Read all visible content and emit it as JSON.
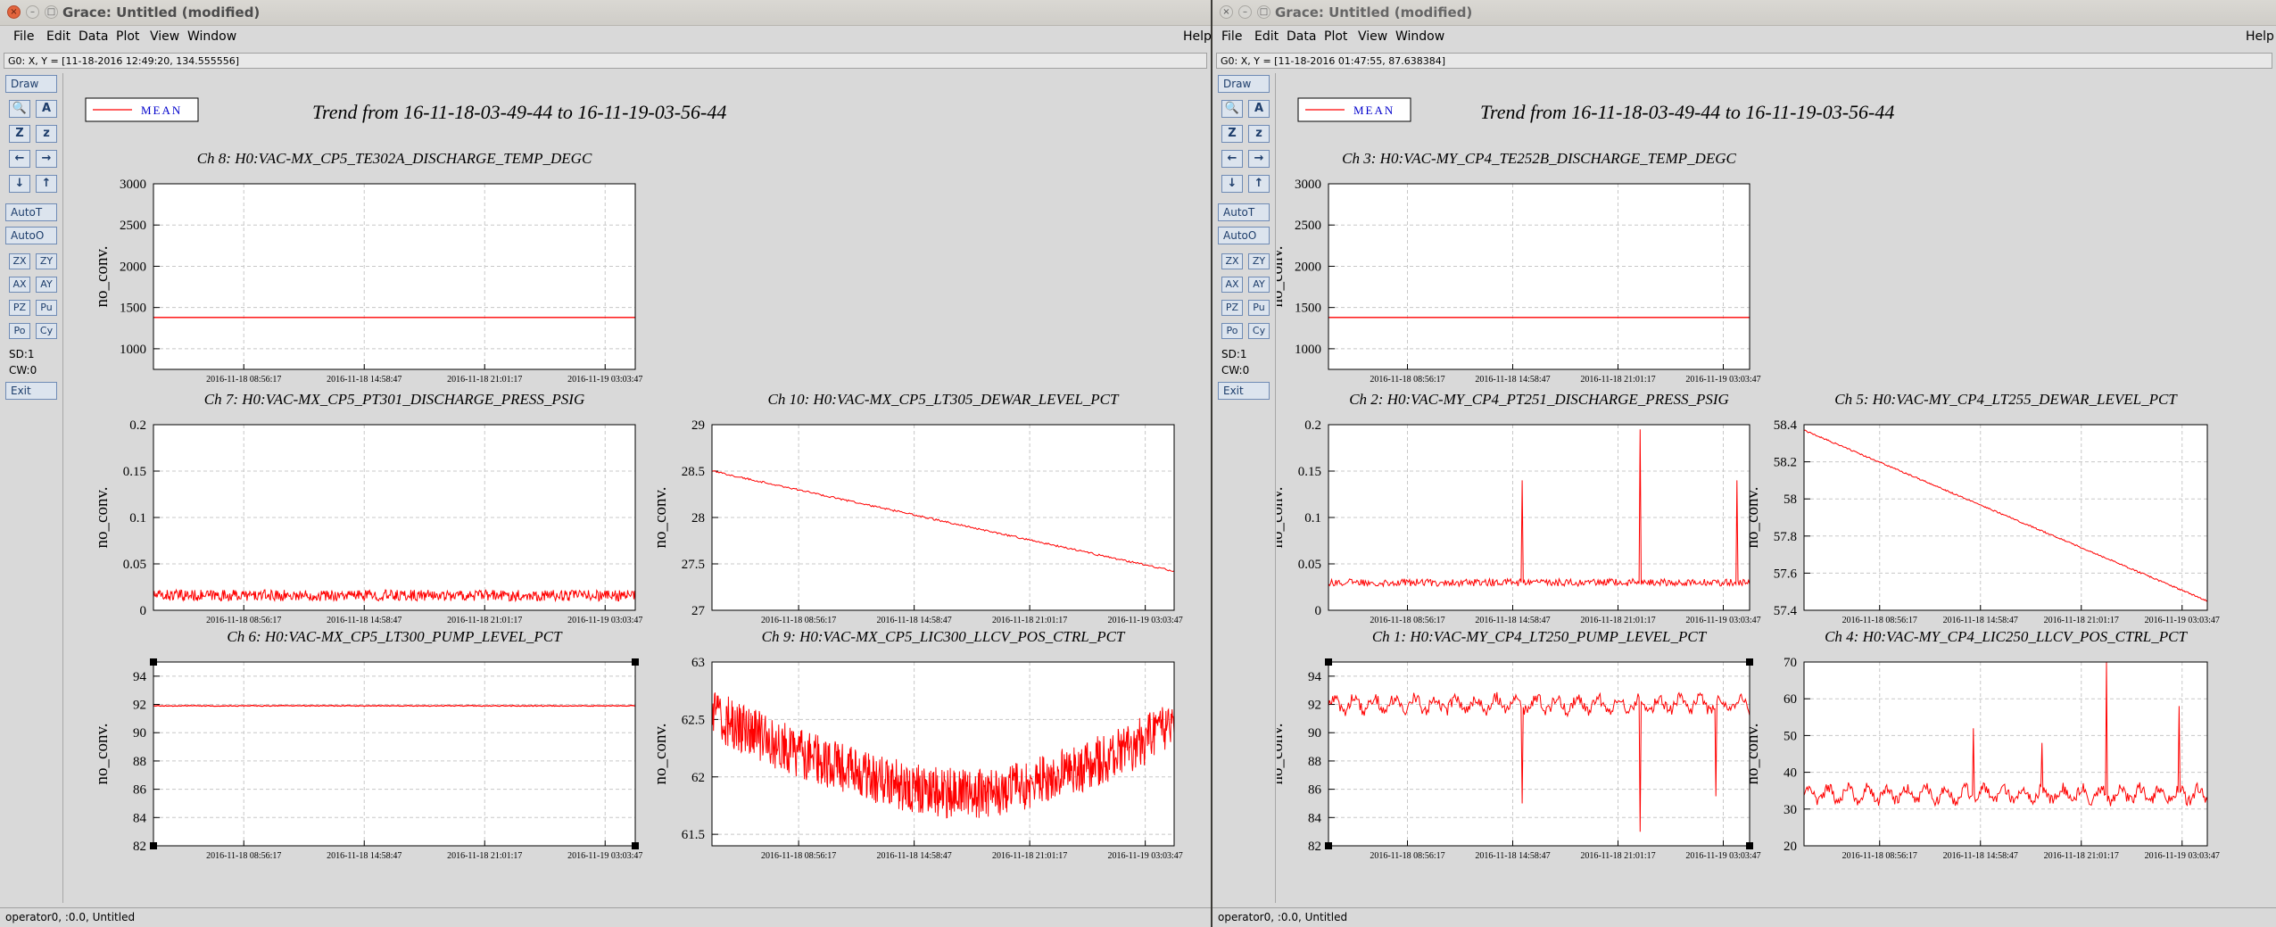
{
  "windows": [
    {
      "id": "L",
      "title": "Grace: Untitled (modified)",
      "status": "G0: X, Y = [11-18-2016 12:49:20, 134.555556]",
      "bottom": "operator0, :0.0, Untitled",
      "legend": "MEAN",
      "heading": "Trend from 16-11-18-03-49-44 to 16-11-19-03-56-44"
    },
    {
      "id": "R",
      "title": "Grace: Untitled (modified)",
      "status": "G0: X, Y = [11-18-2016 01:47:55, 87.638384]",
      "bottom": "operator0, :0.0, Untitled",
      "legend": "MEAN",
      "heading": "Trend from 16-11-18-03-49-44 to 16-11-19-03-56-44"
    }
  ],
  "menu": {
    "file": "File",
    "edit": "Edit",
    "data": "Data",
    "plot": "Plot",
    "view": "View",
    "window": "Window",
    "help": "Help"
  },
  "toolbar": {
    "draw": "Draw",
    "autot": "AutoT",
    "autoo": "AutoO",
    "zx": "ZX",
    "zy": "ZY",
    "ax": "AX",
    "ay": "AY",
    "pz": "PZ",
    "pu": "Pu",
    "po": "Po",
    "cy": "Cy",
    "sd": "SD:1",
    "cw": "CW:0",
    "exit": "Exit",
    "zoom": "Z",
    "zoom2": "z"
  },
  "xticks": [
    "2016-11-18 08:56:17",
    "2016-11-18 14:58:47",
    "2016-11-18 21:01:17",
    "2016-11-19 03:03:47"
  ],
  "ylabel": "no_conv.",
  "chart_data": [
    {
      "window": "L",
      "slot": 0,
      "type": "line",
      "title": "Ch 8: H0:VAC-MX_CP5_TE302A_DISCHARGE_TEMP_DEGC",
      "ylim": [
        750,
        3000
      ],
      "yticks": [
        "1000",
        "1500",
        "2000",
        "2500",
        "3000"
      ],
      "ytickvals": [
        1000,
        1500,
        2000,
        2500,
        3000
      ],
      "pattern": "flat",
      "base": 1380,
      "noise": 0,
      "series": [
        {
          "name": "MEAN"
        }
      ]
    },
    {
      "window": "L",
      "slot": 1,
      "type": "line",
      "title": "Ch 7: H0:VAC-MX_CP5_PT301_DISCHARGE_PRESS_PSIG",
      "ylim": [
        0,
        0.2
      ],
      "yticks": [
        "0",
        "0.05",
        "0.1",
        "0.15",
        "0.2"
      ],
      "ytickvals": [
        0,
        0.05,
        0.1,
        0.15,
        0.2
      ],
      "pattern": "noisy-flat",
      "base": 0.016,
      "noise": 0.006,
      "series": [
        {
          "name": "MEAN"
        }
      ]
    },
    {
      "window": "L",
      "slot": 2,
      "type": "line",
      "title": "Ch 10: H0:VAC-MX_CP5_LT305_DEWAR_LEVEL_PCT",
      "ylim": [
        27,
        29
      ],
      "yticks": [
        "27",
        "27.5",
        "28",
        "28.5",
        "29"
      ],
      "ytickvals": [
        27,
        27.5,
        28,
        28.5,
        29
      ],
      "pattern": "linear",
      "start": 28.5,
      "end": 27.42,
      "noise": 0.01,
      "series": [
        {
          "name": "MEAN"
        }
      ]
    },
    {
      "window": "L",
      "slot": 3,
      "type": "line",
      "title": "Ch 6: H0:VAC-MX_CP5_LT300_PUMP_LEVEL_PCT",
      "ylim": [
        82,
        95
      ],
      "yticks": [
        "82",
        "84",
        "86",
        "88",
        "90",
        "92",
        "94"
      ],
      "ytickvals": [
        82,
        84,
        86,
        88,
        90,
        92,
        94
      ],
      "pattern": "flat",
      "base": 91.9,
      "noise": 0.03,
      "series": [
        {
          "name": "MEAN"
        }
      ]
    },
    {
      "window": "L",
      "slot": 4,
      "type": "line",
      "title": "Ch 9: H0:VAC-MX_CP5_LIC300_LLCV_POS_CTRL_PCT",
      "ylim": [
        61.4,
        63
      ],
      "yticks": [
        "61.5",
        "62",
        "62.5",
        "63"
      ],
      "ytickvals": [
        61.5,
        62,
        62.5,
        63
      ],
      "pattern": "dip",
      "start": 62.55,
      "mid": 61.85,
      "end": 62.45,
      "noise": 0.22,
      "series": [
        {
          "name": "MEAN"
        }
      ]
    },
    {
      "window": "R",
      "slot": 0,
      "type": "line",
      "title": "Ch 3: H0:VAC-MY_CP4_TE252B_DISCHARGE_TEMP_DEGC",
      "ylim": [
        750,
        3000
      ],
      "yticks": [
        "1000",
        "1500",
        "2000",
        "2500",
        "3000"
      ],
      "ytickvals": [
        1000,
        1500,
        2000,
        2500,
        3000
      ],
      "pattern": "flat",
      "base": 1380,
      "noise": 0,
      "series": [
        {
          "name": "MEAN"
        }
      ]
    },
    {
      "window": "R",
      "slot": 1,
      "type": "line",
      "title": "Ch 2: H0:VAC-MY_CP4_PT251_DISCHARGE_PRESS_PSIG",
      "ylim": [
        0,
        0.2
      ],
      "yticks": [
        "0",
        "0.05",
        "0.1",
        "0.15",
        "0.2"
      ],
      "ytickvals": [
        0,
        0.05,
        0.1,
        0.15,
        0.2
      ],
      "pattern": "spiky",
      "base": 0.03,
      "noise": 0.004,
      "spikes": [
        [
          0.46,
          0.14
        ],
        [
          0.74,
          0.195
        ],
        [
          0.97,
          0.14
        ]
      ],
      "series": [
        {
          "name": "MEAN"
        }
      ]
    },
    {
      "window": "R",
      "slot": 2,
      "type": "line",
      "title": "Ch 5: H0:VAC-MY_CP4_LT255_DEWAR_LEVEL_PCT",
      "ylim": [
        57.4,
        58.4
      ],
      "yticks": [
        "57.4",
        "57.6",
        "57.8",
        "58",
        "58.2",
        "58.4"
      ],
      "ytickvals": [
        57.4,
        57.6,
        57.8,
        58,
        58.2,
        58.4
      ],
      "pattern": "linear",
      "start": 58.37,
      "end": 57.45,
      "noise": 0.004,
      "series": [
        {
          "name": "MEAN"
        }
      ]
    },
    {
      "window": "R",
      "slot": 3,
      "type": "line",
      "title": "Ch 1: H0:VAC-MY_CP4_LT250_PUMP_LEVEL_PCT",
      "ylim": [
        82,
        95
      ],
      "yticks": [
        "82",
        "84",
        "86",
        "88",
        "90",
        "92",
        "94"
      ],
      "ytickvals": [
        82,
        84,
        86,
        88,
        90,
        92,
        94
      ],
      "pattern": "wavy-spiky",
      "base": 92,
      "noise": 0.8,
      "spikes": [
        [
          0.46,
          85
        ],
        [
          0.74,
          83
        ],
        [
          0.92,
          85.5
        ]
      ],
      "series": [
        {
          "name": "MEAN"
        }
      ]
    },
    {
      "window": "R",
      "slot": 4,
      "type": "line",
      "title": "Ch 4: H0:VAC-MY_CP4_LIC250_LLCV_POS_CTRL_PCT",
      "ylim": [
        20,
        70
      ],
      "yticks": [
        "20",
        "30",
        "40",
        "50",
        "60",
        "70"
      ],
      "ytickvals": [
        20,
        30,
        40,
        50,
        60,
        70
      ],
      "pattern": "wavy-spiky",
      "base": 34,
      "noise": 3,
      "spikes": [
        [
          0.42,
          52
        ],
        [
          0.59,
          48
        ],
        [
          0.75,
          70
        ],
        [
          0.93,
          58
        ]
      ],
      "series": [
        {
          "name": "MEAN"
        }
      ]
    }
  ],
  "colors": {
    "line": "#ff0000",
    "grid": "#c8c8c8",
    "frame": "#000000"
  }
}
